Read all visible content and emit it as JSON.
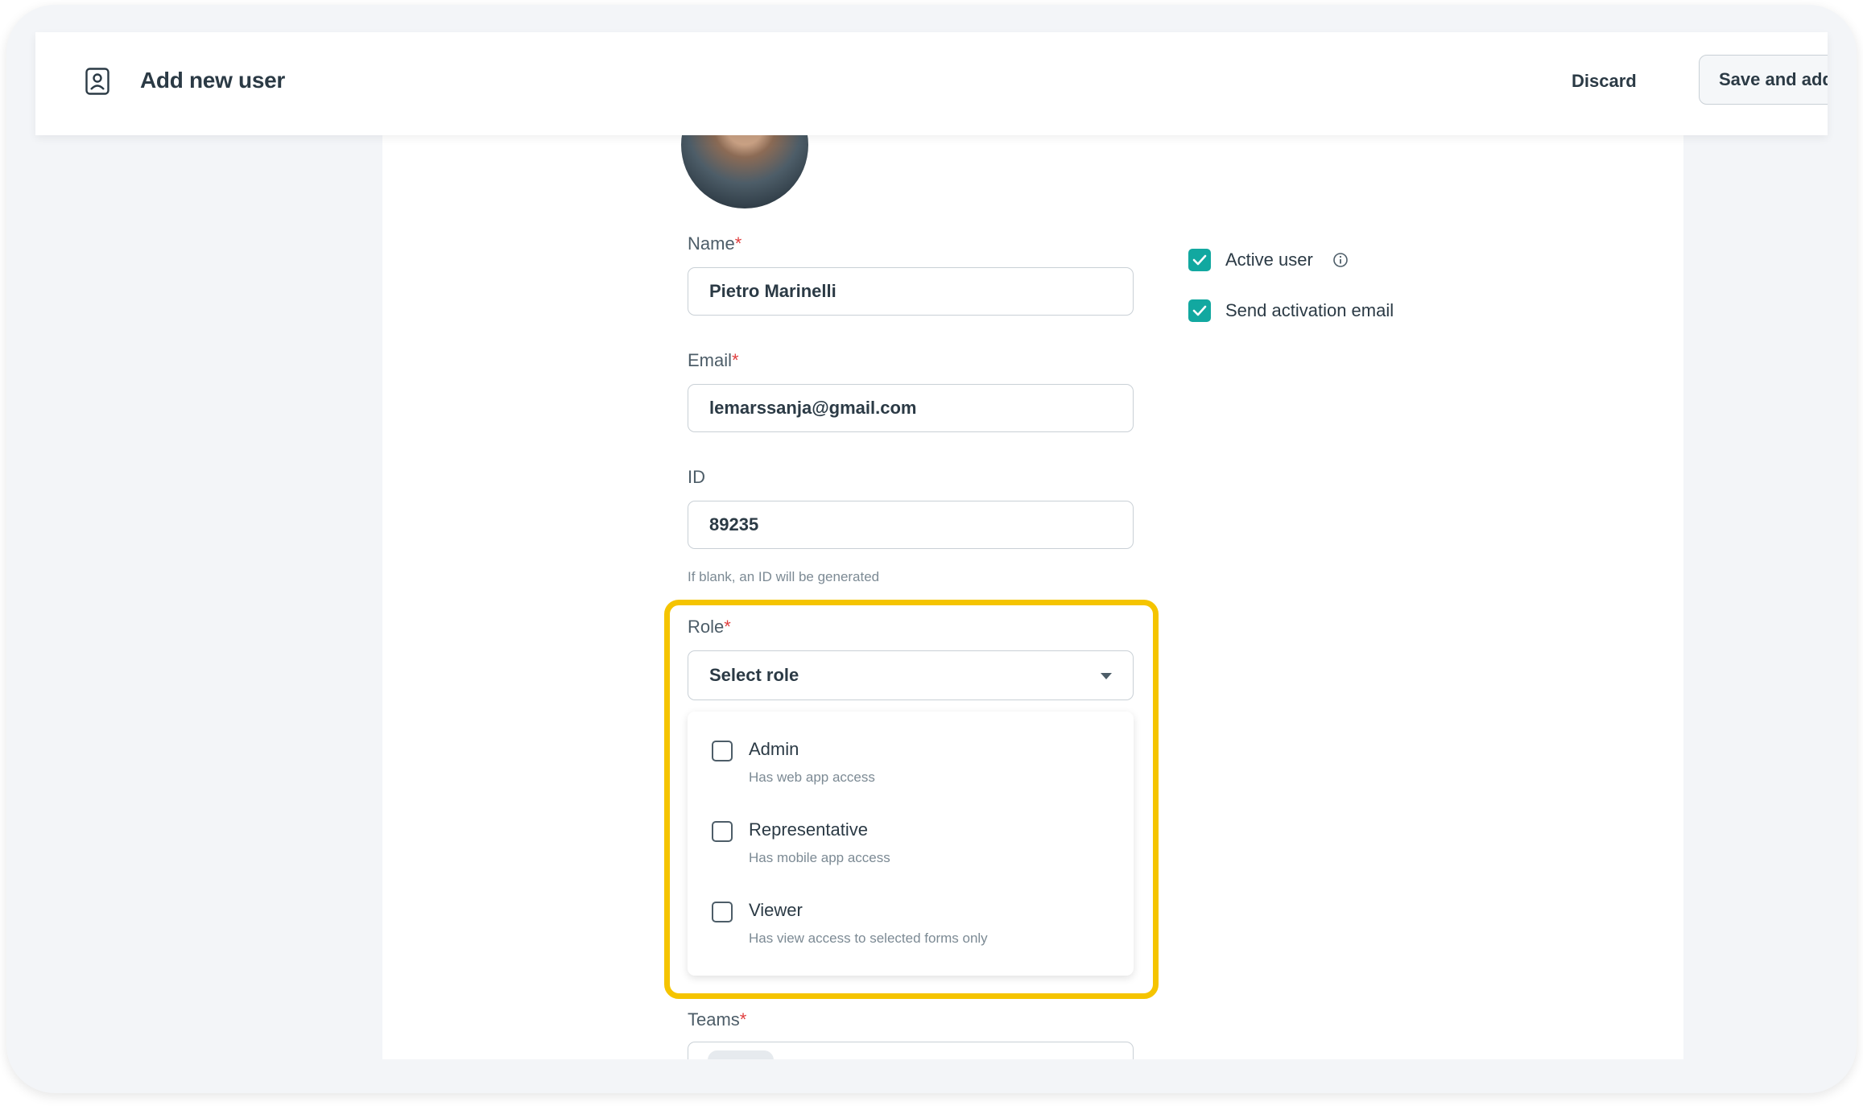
{
  "header": {
    "title": "Add new user",
    "discard_label": "Discard",
    "save_label": "Save and add anot"
  },
  "form": {
    "name": {
      "label": "Name",
      "required_mark": "*",
      "value": "Pietro Marinelli"
    },
    "email": {
      "label": "Email",
      "required_mark": "*",
      "value": "lemarssanja@gmail.com"
    },
    "id": {
      "label": "ID",
      "value": "89235",
      "hint": "If blank, an ID will be generated"
    },
    "role": {
      "label": "Role",
      "required_mark": "*",
      "placeholder": "Select role",
      "options": [
        {
          "label": "Admin",
          "description": "Has web app access",
          "checked": false
        },
        {
          "label": "Representative",
          "description": "Has mobile app access",
          "checked": false
        },
        {
          "label": "Viewer",
          "description": "Has view access to selected forms only",
          "checked": false
        }
      ]
    },
    "teams": {
      "label": "Teams",
      "required_mark": "*"
    }
  },
  "settings": {
    "active_user": {
      "label": "Active user",
      "checked": true
    },
    "send_activation": {
      "label": "Send activation email",
      "checked": true
    }
  },
  "colors": {
    "accent": "#12a8a0",
    "highlight": "#f5c400",
    "required": "#e03e3e"
  },
  "icons": [
    "user-profile-icon",
    "info-icon",
    "checkmark-icon",
    "chevron-down-icon"
  ]
}
